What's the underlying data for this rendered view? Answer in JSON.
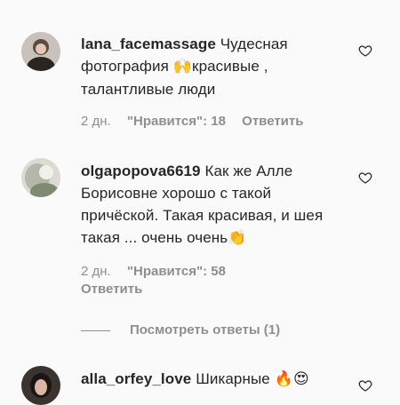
{
  "comments": [
    {
      "username": "lana_facemassage",
      "text_part1": "Чудесная фотография ",
      "emoji": "🙌",
      "text_part2": "красивые , талантливые люди",
      "time": "2 дн.",
      "likes": "\"Нравится\": 18",
      "reply": "Ответить"
    },
    {
      "username": "olgapopova6619",
      "text_part1": "Как же Алле Борисовне хорошо с такой причёской. Такая красивая, и шея такая ... очень очень",
      "emoji": "👏",
      "time": "2 дн.",
      "likes": "\"Нравится\": 58",
      "reply": "Ответить",
      "view_replies": "Посмотреть ответы (1)"
    },
    {
      "username": "alla_orfey_love",
      "text_part1": "Шикарные ",
      "emoji": "🔥😍"
    }
  ],
  "icons": {
    "heart": "heart-outline-icon",
    "avatar": "avatar-image"
  },
  "colors": {
    "text": "#262626",
    "secondary": "#8e8e8e",
    "background": "#fafafa"
  }
}
